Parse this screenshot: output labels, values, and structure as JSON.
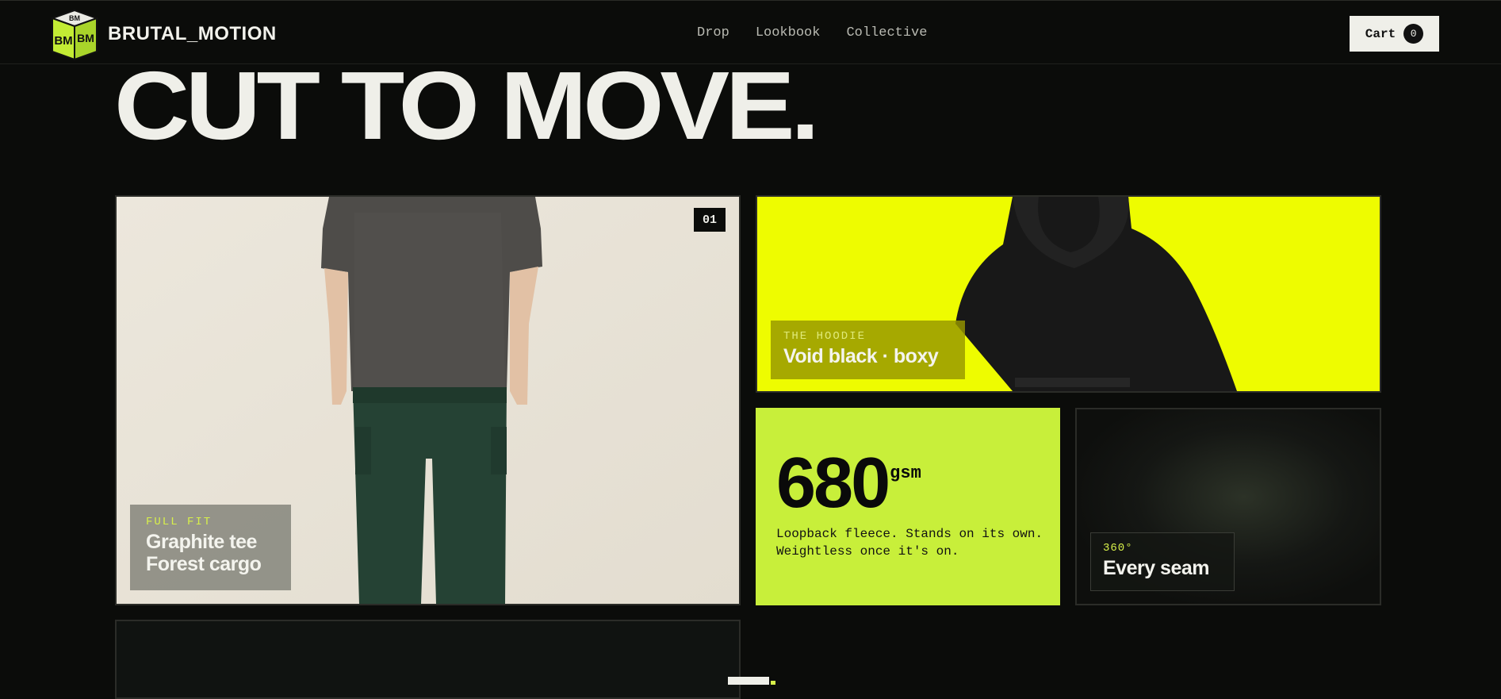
{
  "brand": {
    "logo_text": "BM",
    "name": "BRUTAL_MOTION",
    "accent": "#c8ef3a"
  },
  "nav": {
    "items": [
      "Drop",
      "Lookbook",
      "Collective"
    ]
  },
  "cart": {
    "label": "Cart",
    "count": "0"
  },
  "hero": {
    "headline": "CUT TO MOVE."
  },
  "cards": {
    "outfit": {
      "badge": "01",
      "kicker": "FULL FIT",
      "title_line1": "Graphite tee",
      "title_line2": "Forest cargo"
    },
    "hoodie": {
      "kicker": "THE HOODIE",
      "title": "Void black · boxy",
      "bg_color": "#eefc00"
    },
    "fabric": {
      "number": "680",
      "unit": "gsm",
      "desc_line1": "Loopback fleece. Stands on its own.",
      "desc_line2": "Weightless once it's on.",
      "bg_color": "#c8ef3a"
    },
    "seam": {
      "kicker": "360°",
      "title": "Every seam"
    }
  }
}
